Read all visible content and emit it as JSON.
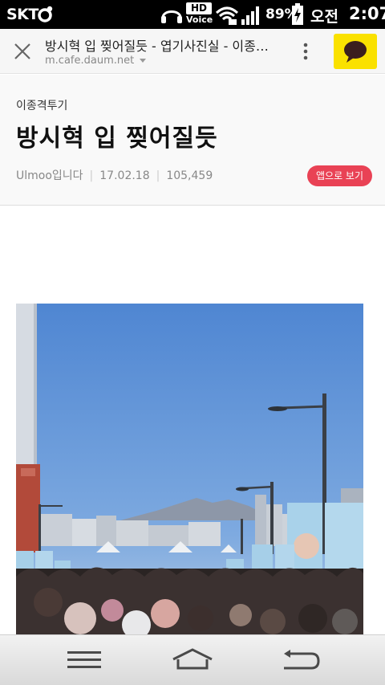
{
  "status_bar": {
    "carrier": "SKT",
    "hd_label": "HD",
    "voice_label": "Voice",
    "battery_percent": "89%",
    "ampm": "오전",
    "time": "2:07"
  },
  "url_bar": {
    "page_title": "방시혁 입 찢어질듯 - 엽기사진실 - 이종…",
    "domain": "m.cafe.daum.net"
  },
  "article": {
    "board": "이종격투기",
    "title": "방시혁 입 찢어질듯",
    "author": "Ulmoo입니다",
    "date": "17.02.18",
    "views": "105,459",
    "app_button": "앱으로 보기"
  },
  "colors": {
    "accent_red": "#e94255",
    "kakao_yellow": "#fae100",
    "sky_blue": "#5d8fd4"
  },
  "icons": [
    "close-icon",
    "more-vertical-icon",
    "kakaotalk-icon",
    "menu-icon",
    "home-icon",
    "back-icon"
  ]
}
